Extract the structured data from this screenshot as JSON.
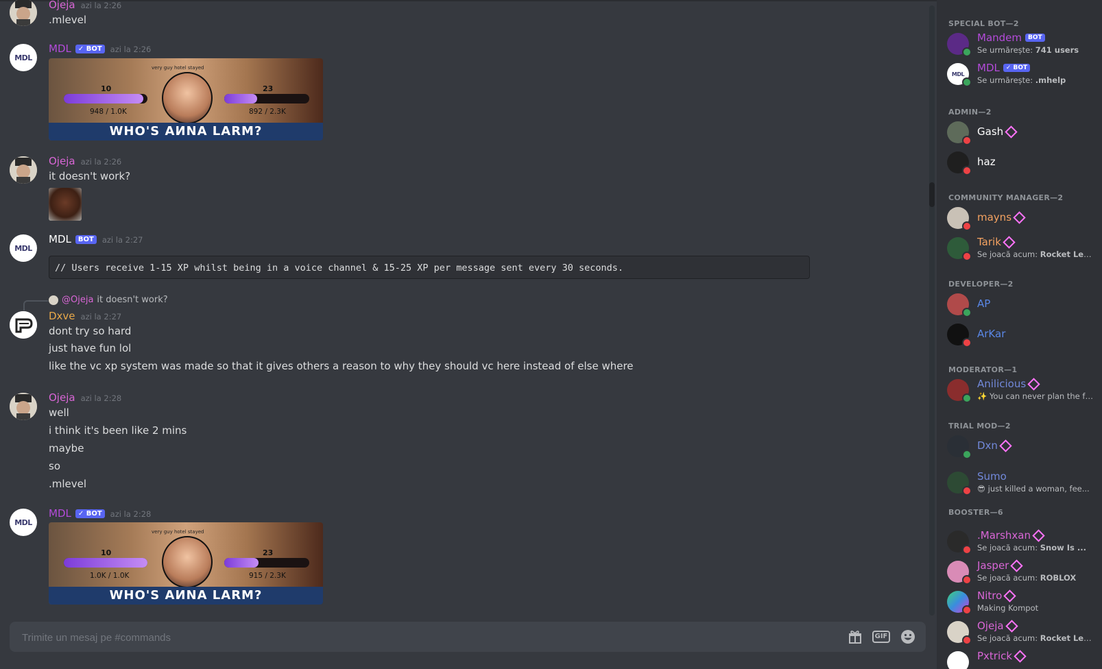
{
  "messages": {
    "m1": {
      "author": "Ojeja",
      "timestamp": "azi la 2:26",
      "lines": [
        ".mlevel"
      ]
    },
    "m2": {
      "author": "MDL",
      "bot_badge": "✓ BOT",
      "timestamp": "azi la 2:26",
      "card": {
        "level": "10",
        "level_xp": "948 / 1.0K",
        "rank": "23",
        "rank_xp": "892 / 2.3K",
        "banner": "WHO'S AИNA LARM?",
        "top_text": "very guy hotel stayed",
        "level_progress": 0.948,
        "rank_progress": 0.39
      }
    },
    "m3": {
      "author": "Ojeja",
      "timestamp": "azi la 2:26",
      "lines": [
        "it doesn't work?"
      ]
    },
    "m4": {
      "author": "MDL",
      "bot_badge": "BOT",
      "timestamp": "azi la 2:27",
      "code": "// Users receive 1-15 XP whilst being in a voice channel & 15-25 XP per message sent every 30 seconds."
    },
    "m5": {
      "reply_to": "@Ojeja",
      "reply_text": "it doesn't work?",
      "author": "Dxve",
      "timestamp": "azi la 2:27",
      "lines": [
        "dont try so hard",
        "just have fun lol",
        "like the vc xp system was made so that it gives others a reason to why they should vc here instead of else where"
      ]
    },
    "m6": {
      "author": "Ojeja",
      "timestamp": "azi la 2:28",
      "lines": [
        "well",
        "i think it's been like 2 mins",
        "maybe",
        "so",
        ".mlevel"
      ]
    },
    "m7": {
      "author": "MDL",
      "bot_badge": "✓ BOT",
      "timestamp": "azi la 2:28",
      "card": {
        "level": "10",
        "level_xp": "1.0K / 1.0K",
        "rank": "23",
        "rank_xp": "915 / 2.3K",
        "banner": "WHO'S AИNA LARM?",
        "top_text": "very guy hotel stayed",
        "level_progress": 1.0,
        "rank_progress": 0.4
      }
    }
  },
  "input": {
    "placeholder": "Trimite un mesaj pe #commands"
  },
  "input_icons": {
    "gift": "gift-icon",
    "gif": "GIF",
    "emoji": "emoji-icon"
  },
  "avatar_text": {
    "mdl": "MDL"
  },
  "members": {
    "special_bot": {
      "title": "SPECIAL BOT—2",
      "items": [
        {
          "name": "Mandem",
          "badge": "BOT",
          "status_prefix": "Se urmărește: ",
          "status_bold": "741 users"
        },
        {
          "name": "MDL",
          "badge": "✓ BOT",
          "status_prefix": "Se urmărește: ",
          "status_bold": ".mhelp"
        }
      ]
    },
    "admin": {
      "title": "ADMIN—2",
      "items": [
        {
          "name": "Gash"
        },
        {
          "name": "haz"
        }
      ]
    },
    "community_manager": {
      "title": "COMMUNITY MANAGER—2",
      "items": [
        {
          "name": "mayns"
        },
        {
          "name": "Tarik",
          "status_prefix": "Se joacă acum: ",
          "status_bold": "Rocket Lea..."
        }
      ]
    },
    "developer": {
      "title": "DEVELOPER—2",
      "items": [
        {
          "name": "AP"
        },
        {
          "name": "ArKar"
        }
      ]
    },
    "moderator": {
      "title": "MODERATOR—1",
      "items": [
        {
          "name": "Anilicious",
          "status": "✨ You can never plan the fut..."
        }
      ]
    },
    "trial_mod": {
      "title": "TRIAL MOD—2",
      "items": [
        {
          "name": "Dxn"
        },
        {
          "name": "Sumo",
          "status": "😎 just killed a woman, fee..."
        }
      ]
    },
    "booster": {
      "title": "BOOSTER—6",
      "items": [
        {
          "name": ".Marshxan",
          "status_prefix": "Se joacă acum: ",
          "status_bold": "Snow Is ..."
        },
        {
          "name": "Jasper",
          "status_prefix": "Se joacă acum: ",
          "status_bold": "ROBLOX"
        },
        {
          "name": "Nitro",
          "status": "Making Kompot"
        },
        {
          "name": "Ojeja",
          "status_prefix": "Se joacă acum: ",
          "status_bold": "Rocket Lea..."
        },
        {
          "name": "Pxtrick"
        }
      ]
    }
  },
  "colors": {
    "chat_bg": "#36393f",
    "sidebar_bg": "#2f3136",
    "bot_badge": "#5865f2",
    "online": "#3ba55c",
    "dnd": "#ed4245",
    "booster": "#ff73fa"
  }
}
